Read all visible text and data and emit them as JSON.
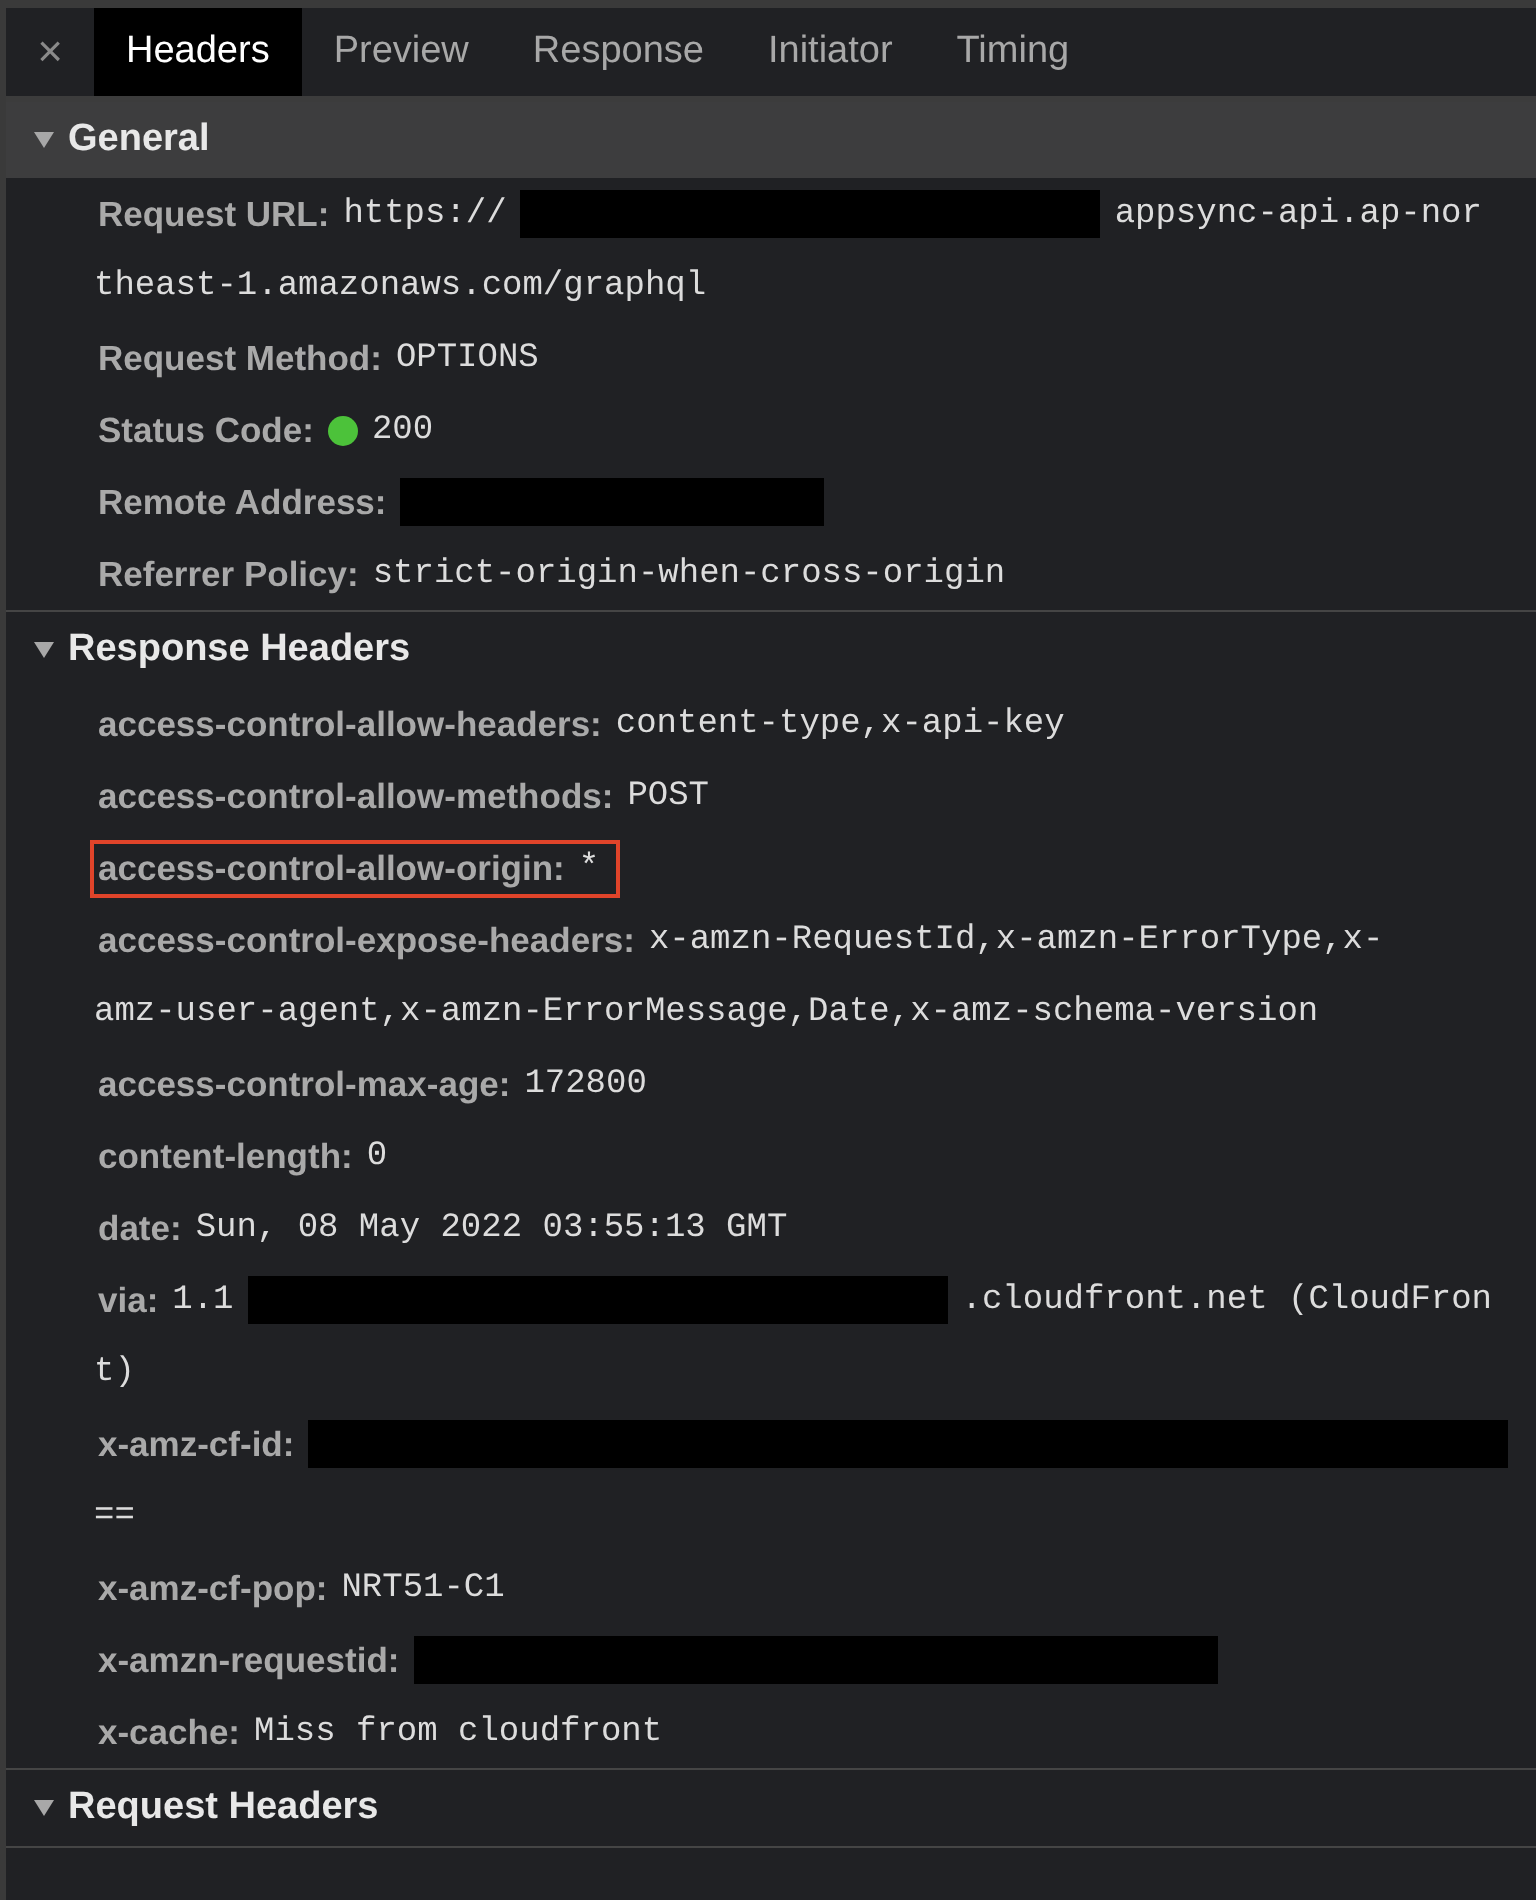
{
  "tabs": {
    "close": "×",
    "items": [
      {
        "label": "Headers",
        "selected": true
      },
      {
        "label": "Preview",
        "selected": false
      },
      {
        "label": "Response",
        "selected": false
      },
      {
        "label": "Initiator",
        "selected": false
      },
      {
        "label": "Timing",
        "selected": false
      }
    ]
  },
  "sections": [
    {
      "title": "General",
      "expanded": true,
      "focused": true,
      "rows": [
        {
          "label": "Request URL:",
          "highlighted": false,
          "lines": [
            [
              {
                "kind": "text",
                "text": "https://"
              },
              {
                "kind": "redacted"
              },
              {
                "kind": "text",
                "text": "appsync-api.ap-nor"
              }
            ],
            [
              {
                "kind": "text",
                "text": "theast-1.amazonaws.com/graphql"
              }
            ]
          ]
        },
        {
          "label": "Request Method:",
          "highlighted": false,
          "lines": [
            [
              {
                "kind": "text",
                "text": "OPTIONS"
              }
            ]
          ]
        },
        {
          "label": "Status Code:",
          "highlighted": false,
          "lines": [
            [
              {
                "kind": "dot",
                "color": "#4cc23a"
              },
              {
                "kind": "text",
                "text": "200"
              }
            ]
          ]
        },
        {
          "label": "Remote Address:",
          "highlighted": false,
          "lines": [
            [
              {
                "kind": "redacted"
              }
            ]
          ]
        },
        {
          "label": "Referrer Policy:",
          "highlighted": false,
          "lines": [
            [
              {
                "kind": "text",
                "text": "strict-origin-when-cross-origin"
              }
            ]
          ]
        }
      ]
    },
    {
      "title": "Response Headers",
      "expanded": true,
      "focused": false,
      "rows": [
        {
          "label": "access-control-allow-headers:",
          "highlighted": false,
          "lines": [
            [
              {
                "kind": "text",
                "text": "content-type,x-api-key"
              }
            ]
          ]
        },
        {
          "label": "access-control-allow-methods:",
          "highlighted": false,
          "lines": [
            [
              {
                "kind": "text",
                "text": "POST"
              }
            ]
          ]
        },
        {
          "label": "access-control-allow-origin:",
          "highlighted": true,
          "lines": [
            [
              {
                "kind": "text",
                "text": "*"
              }
            ]
          ]
        },
        {
          "label": "access-control-expose-headers:",
          "highlighted": false,
          "lines": [
            [
              {
                "kind": "text",
                "text": "x-amzn-RequestId,x-amzn-ErrorType,x-"
              }
            ],
            [
              {
                "kind": "text",
                "text": "amz-user-agent,x-amzn-ErrorMessage,Date,x-amz-schema-version"
              }
            ]
          ]
        },
        {
          "label": "access-control-max-age:",
          "highlighted": false,
          "lines": [
            [
              {
                "kind": "text",
                "text": "172800"
              }
            ]
          ]
        },
        {
          "label": "content-length:",
          "highlighted": false,
          "lines": [
            [
              {
                "kind": "text",
                "text": "0"
              }
            ]
          ]
        },
        {
          "label": "date:",
          "highlighted": false,
          "lines": [
            [
              {
                "kind": "text",
                "text": "Sun, 08 May 2022 03:55:13 GMT"
              }
            ]
          ]
        },
        {
          "label": "via:",
          "highlighted": false,
          "lines": [
            [
              {
                "kind": "text",
                "text": "1.1"
              },
              {
                "kind": "redacted"
              },
              {
                "kind": "text",
                "text": ".cloudfront.net (CloudFron"
              }
            ],
            [
              {
                "kind": "text",
                "text": "t)"
              }
            ]
          ]
        },
        {
          "label": "x-amz-cf-id:",
          "highlighted": false,
          "lines": [
            [
              {
                "kind": "redacted"
              }
            ],
            [
              {
                "kind": "text",
                "text": "=="
              }
            ]
          ]
        },
        {
          "label": "x-amz-cf-pop:",
          "highlighted": false,
          "lines": [
            [
              {
                "kind": "text",
                "text": "NRT51-C1"
              }
            ]
          ]
        },
        {
          "label": "x-amzn-requestid:",
          "highlighted": false,
          "lines": [
            [
              {
                "kind": "redacted"
              }
            ]
          ]
        },
        {
          "label": "x-cache:",
          "highlighted": false,
          "lines": [
            [
              {
                "kind": "text",
                "text": "Miss from cloudfront"
              }
            ]
          ]
        }
      ]
    },
    {
      "title": "Request Headers",
      "expanded": true,
      "focused": false
    }
  ]
}
